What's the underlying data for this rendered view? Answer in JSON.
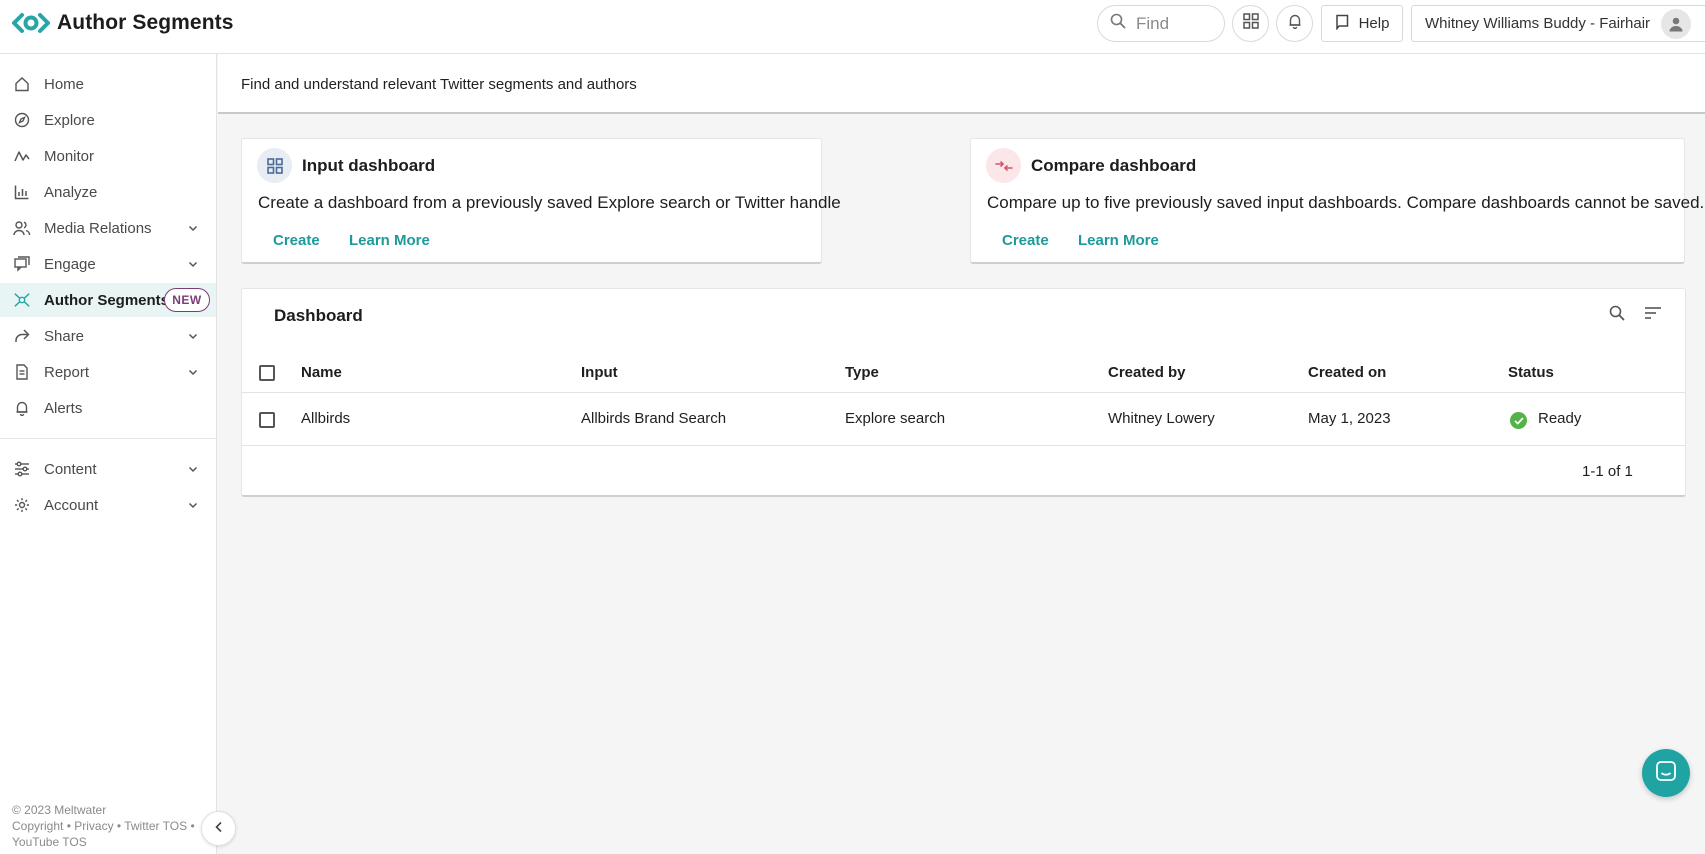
{
  "header": {
    "app_title": "Author Segments",
    "find_placeholder": "Find",
    "help_label": "Help",
    "account_name": "Whitney Williams Buddy - Fairhair"
  },
  "sidebar": {
    "items": [
      {
        "label": "Home",
        "icon": "home-icon"
      },
      {
        "label": "Explore",
        "icon": "compass-icon"
      },
      {
        "label": "Monitor",
        "icon": "pulse-icon"
      },
      {
        "label": "Analyze",
        "icon": "bar-chart-icon"
      },
      {
        "label": "Media Relations",
        "icon": "people-icon",
        "expandable": true
      },
      {
        "label": "Engage",
        "icon": "chat-icon",
        "expandable": true
      },
      {
        "label": "Author Segments",
        "icon": "network-icon",
        "active": true,
        "badge": "NEW"
      },
      {
        "label": "Share",
        "icon": "share-icon",
        "expandable": true
      },
      {
        "label": "Report",
        "icon": "document-icon",
        "expandable": true
      },
      {
        "label": "Alerts",
        "icon": "bell-icon"
      },
      {
        "label": "Content",
        "icon": "sliders-icon",
        "expandable": true
      },
      {
        "label": "Account",
        "icon": "gear-icon",
        "expandable": true
      }
    ],
    "footer": {
      "copyright": "© 2023 Meltwater",
      "links_line1": "Copyright • Privacy • Twitter TOS •",
      "links_line2": "YouTube TOS"
    }
  },
  "main": {
    "description": "Find and understand relevant Twitter segments and authors",
    "cards": [
      {
        "title": "Input dashboard",
        "description": "Create a dashboard from a previously saved Explore search or Twitter handle",
        "create_label": "Create",
        "learn_more_label": "Learn More"
      },
      {
        "title": "Compare dashboard",
        "description": "Compare up to five previously saved input dashboards. Compare dashboards cannot be saved.",
        "create_label": "Create",
        "learn_more_label": "Learn More"
      }
    ],
    "table": {
      "title": "Dashboard",
      "columns": [
        "Name",
        "Input",
        "Type",
        "Created by",
        "Created on",
        "Status"
      ],
      "rows": [
        [
          "Allbirds",
          "Allbirds Brand Search",
          "Explore search",
          "Whitney Lowery",
          "May 1, 2023",
          "Ready"
        ]
      ],
      "pagination": "1-1 of 1"
    }
  },
  "colors": {
    "accent": "#1f9a9a",
    "badge": "#7b3d78",
    "status_ready": "#53b248",
    "active_nav_bg": "#e9f4f4"
  }
}
